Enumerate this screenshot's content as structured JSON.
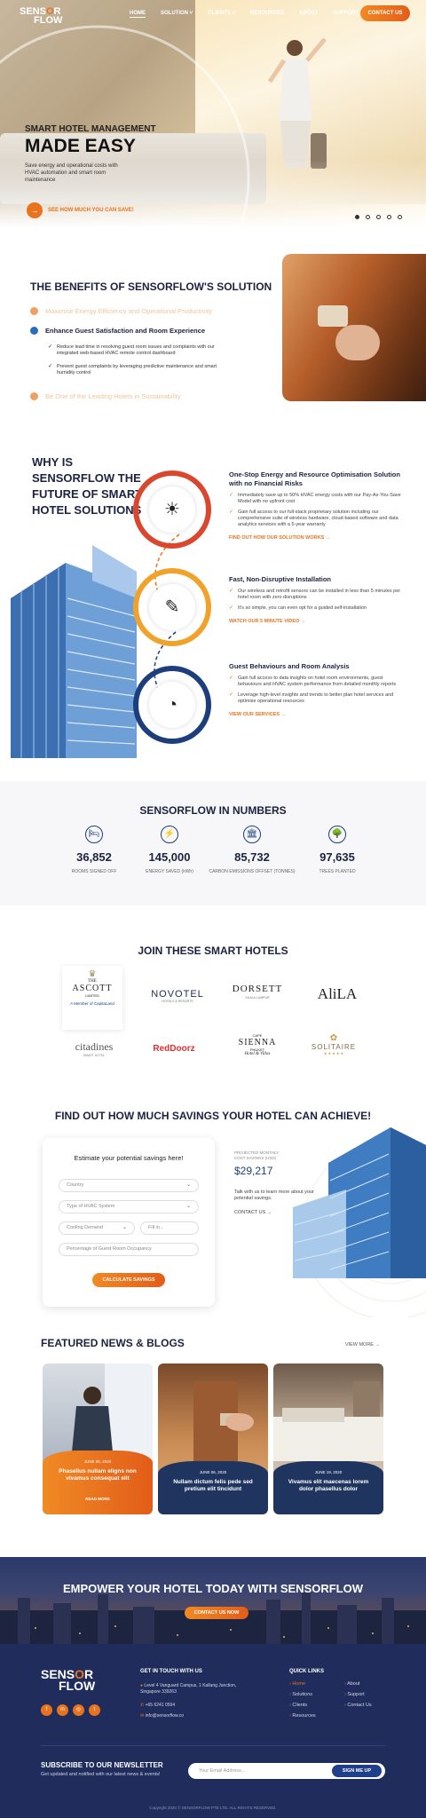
{
  "nav": {
    "logo_line1": "SENS",
    "logo_o": "O",
    "logo_line1_end": "R",
    "logo_line2": "FLOW",
    "items": [
      "HOME",
      "SOLUTION ˅",
      "CLIENTS ˅",
      "RESOURCES",
      "ABOUT",
      "SUPPORT"
    ],
    "contact": "CONTACT US"
  },
  "hero": {
    "subtitle": "SMART HOTEL MANAGEMENT",
    "title": "MADE EASY",
    "desc": "Save energy and operational costs with HVAC automation and smart room maintenance",
    "cta": "SEE HOW MUCH YOU CAN SAVE!",
    "slides": 5,
    "active_slide": 1
  },
  "benefits": {
    "title": "THE BENEFITS OF SENSORFLOW'S SOLUTION",
    "items": [
      "Maximise Energy Efficiency and Operational Productivity",
      "Enhance Guest Satisfaction and Room Experience",
      "Be One of the Leading Hotels in Sustainability"
    ],
    "bullets": [
      "Reduce lead time in resolving guest room issues and complaints with our integrated web-based HVAC remote control dashboard",
      "Prevent guest complaints by leveraging predictive maintenance and smart humidity control"
    ]
  },
  "why": {
    "title": "WHY IS SENSORFLOW THE FUTURE OF SMART HOTEL SOLUTIONS",
    "blocks": [
      {
        "title": "One-Stop Energy and Resource Optimisation Solution with no Financial Risks",
        "bullets": [
          "Immediately save up to 50% HVAC energy costs with our Pay-As-You-Save Model with no upfront cost",
          "Gain full access to our full-stack proprietary solution including our comprehensive suite of wireless hardware, cloud-based software and data analytics services with a 5-year warranty"
        ],
        "link": "FIND OUT HOW OUR SOLUTION WORKS  →"
      },
      {
        "title": "Fast, Non-Disruptive Installation",
        "bullets": [
          "Our wireless and retrofit sensors can be installed in less than 5 minutes per hotel room with zero disruptions",
          "It's so simple, you can even opt for a guided self-installation"
        ],
        "link": "WATCH OUR 5 MINUTE VIDEO  →"
      },
      {
        "title": "Guest Behaviours and Room Analysis",
        "bullets": [
          "Gain full access to data insights on hotel room environments, guest behaviours and HVAC system performance from detailed monthly reports",
          "Leverage high-level insights and trends to better plan hotel services and optimise operational resources"
        ],
        "link": "VIEW OUR SERVICES  →"
      }
    ]
  },
  "numbers": {
    "title": "SENSORFLOW IN NUMBERS",
    "items": [
      {
        "icon": "🛏",
        "value": "36,852",
        "label": "ROOMS SIGNED OFF"
      },
      {
        "icon": "⚡",
        "value": "145,000",
        "label": "ENERGY SAVED (kWh)"
      },
      {
        "icon": "🏛",
        "value": "85,732",
        "label": "CARBON EMISSIONS OFFSET (TONNES)"
      },
      {
        "icon": "🌳",
        "value": "97,635",
        "label": "TREES PLANTED"
      }
    ]
  },
  "hotels": {
    "title": "JOIN THESE SMART HOTELS",
    "ascott_line1": "THE",
    "ascott_name": "ASCOTT",
    "ascott_line3": "LIMITED",
    "ascott_sub": "A Member of CapitaLand",
    "novotel": "NOVOTEL",
    "novotel_sub": "HOTELS & RESORTS",
    "dorsett": "DORSETT",
    "dorsett_sub": "KUALA LUMPUR",
    "alila": "AliLA",
    "citadines": "citadines",
    "citadines_sub": "SMART HOTEL",
    "reddoorz": "RedDoorz",
    "sienna_top": "CAPE",
    "sienna": "SIENNA",
    "sienna_sub": "PHUKET",
    "sienna_sub2": "Hotel & Villas",
    "solitaire": "SOLITAIRE",
    "solitaire_sub": "★ ★ ★ ★ ★"
  },
  "savings": {
    "title": "FIND OUT HOW MUCH SAVINGS YOUR HOTEL CAN ACHIEVE!",
    "form_title": "Estimate your potential savings here!",
    "country": "Country",
    "hvac": "Type of HVAC System",
    "cooling": "Cooling Demand",
    "fillin": "Fill in...",
    "occupancy": "Percentage of Guest Room Occupancy",
    "button": "CALCULATE SAVINGS",
    "projected_label": "PROJECTED MONTHLY COST SAVINGS (USD)",
    "projected_value": "$29,217",
    "talk": "Talk with us to learn more about your potential savings.",
    "contact": "CONTACT US  →"
  },
  "news": {
    "title": "FEATURED NEWS & BLOGS",
    "view_more": "VIEW MORE  →",
    "cards": [
      {
        "date": "JUNE 05, 2020",
        "title": "Phasellus nullam eligns non vivamus consequat elit",
        "more": "READ MORE"
      },
      {
        "date": "JUNE 06, 2020",
        "title": "Nullam dictum felis pede sed pretium elit tincidunt",
        "more": ""
      },
      {
        "date": "JUNE 19, 2020",
        "title": "Vivamus elit maecenas lorem dolor phasellus dolor",
        "more": ""
      }
    ]
  },
  "cta": {
    "title": "EMPOWER YOUR HOTEL TODAY WITH SENSORFLOW",
    "button": "CONTACT US NOW"
  },
  "footer": {
    "touch_title": "GET IN TOUCH WITH US",
    "address": "Level 4 Vanguard Campus, 1 Kallang Junction, Singapore 339263",
    "phone": "+65 6241 0594",
    "email": "info@sensorflow.co",
    "links_title": "QUICK LINKS",
    "links_col1": [
      "Home",
      "Solutions",
      "Clients",
      "Resources"
    ],
    "links_col2": [
      "About",
      "Support",
      "Contact Us"
    ],
    "newsletter_title": "SUBSCRIBE TO OUR NEWSLETTER",
    "newsletter_desc": "Get updated and notified with our latest news & events!",
    "email_placeholder": "Your Email Address...",
    "signup": "SIGN ME UP",
    "copyright": "Copyright 2020 © SENSORFLOW PTE LTD. ALL RIGHTS RESERVED."
  },
  "colors": {
    "accent": "#e8731f",
    "navy": "#1c2240",
    "blue": "#1c3f7c"
  }
}
